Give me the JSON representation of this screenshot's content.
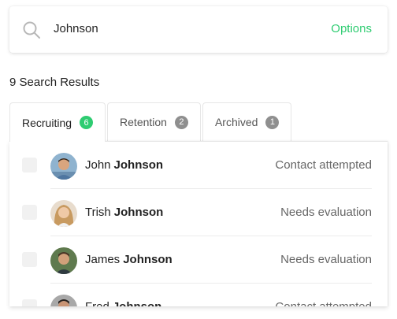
{
  "search": {
    "value": "Johnson",
    "options_label": "Options"
  },
  "results": {
    "count_label": "9 Search Results"
  },
  "tabs": [
    {
      "label": "Recruiting",
      "count": "6",
      "active": true,
      "badge_color": "#2ecc71"
    },
    {
      "label": "Retention",
      "count": "2",
      "active": false,
      "badge_color": "#8f8f8f"
    },
    {
      "label": "Archived",
      "count": "1",
      "active": false,
      "badge_color": "#8f8f8f"
    }
  ],
  "rows": [
    {
      "first": "John",
      "last": "Johnson",
      "status": "Contact attempted",
      "avatar": "avatar-john"
    },
    {
      "first": "Trish",
      "last": "Johnson",
      "status": "Needs evaluation",
      "avatar": "avatar-trish"
    },
    {
      "first": "James",
      "last": "Johnson",
      "status": "Needs evaluation",
      "avatar": "avatar-james"
    },
    {
      "first": "Fred",
      "last": "Johnson",
      "status": "Contact attempted",
      "avatar": "avatar-fred"
    }
  ],
  "colors": {
    "accent": "#2ecc71",
    "badge_gray": "#8f8f8f"
  }
}
